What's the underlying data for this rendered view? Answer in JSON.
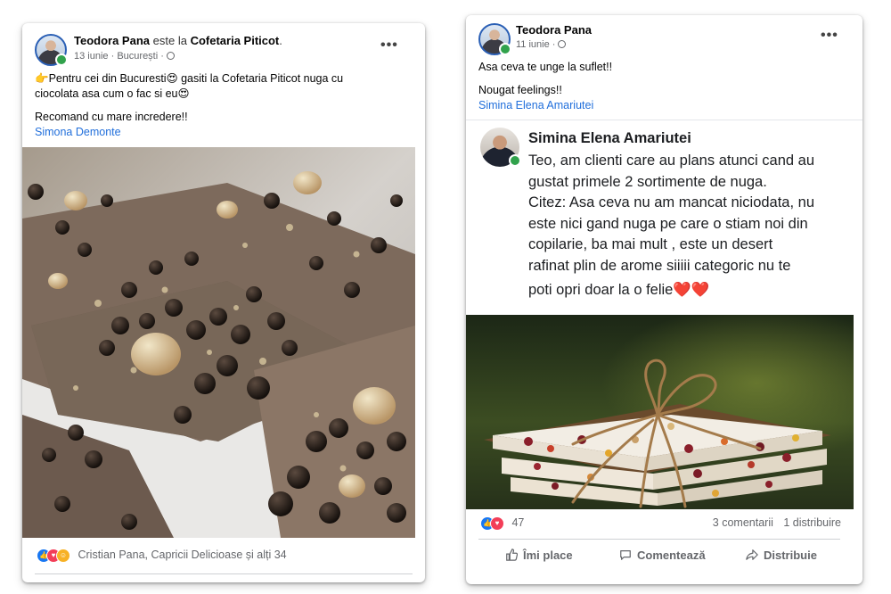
{
  "left_post": {
    "author": "Teodora Pana",
    "at_word": "este la",
    "place": "Cofetaria Piticot",
    "date": "13 iunie",
    "location": "București",
    "line1": "👉Pentru cei din Bucuresti😍 gasiti la Cofetaria Piticot nuga cu",
    "line2": "ciocolata asa cum o fac si eu😍",
    "line3": "Recomand cu mare incredere!!",
    "mention": "Simona Demonte",
    "reactions_text": "Cristian Pana, Capricii Delicioase și alți 34",
    "more_icon": "more-horizontal-icon"
  },
  "right_post": {
    "author": "Teodora Pana",
    "date": "11 iunie",
    "line1": "Asa ceva te unge la suflet!!",
    "line2": "Nougat feelings!!",
    "mention": "Simina Elena Amariutei",
    "quote_author": "Simina Elena Amariutei",
    "quote_lines": [
      "Teo, am clienti care au plans atunci cand au",
      "gustat primele 2 sortimente de nuga.",
      "Citez: Asa ceva nu am mancat niciodata, nu",
      "este nici gand nuga pe care o stiam noi din",
      "copilarie, ba  mai mult , este un desert",
      "rafinat plin de arome siiiii categoric nu te",
      "poti opri doar la o felie❤️❤️"
    ],
    "reaction_count": "47",
    "comments": "3 comentarii",
    "shares": "1 distribuire",
    "actions": {
      "like": "Îmi place",
      "comment": "Comentează",
      "share": "Distribuie"
    },
    "more_icon": "more-horizontal-icon"
  },
  "colors": {
    "link": "#216fdb",
    "like": "#1877f2",
    "love": "#f33e58",
    "online": "#31a24c"
  }
}
